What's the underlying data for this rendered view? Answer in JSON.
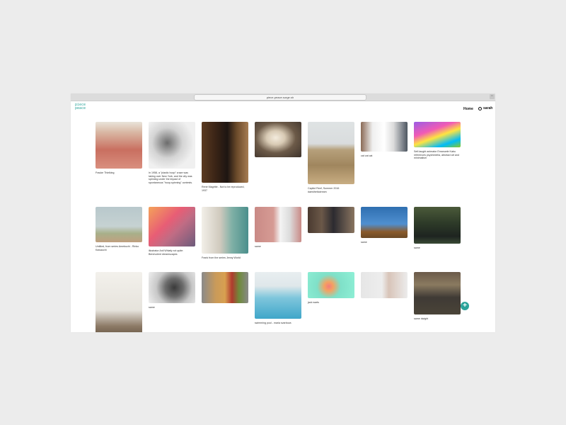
{
  "browser": {
    "url": "piece-peace.surge.sh"
  },
  "header": {
    "logo_line1": "piece",
    "logo_line2": "peace",
    "home": "Home",
    "user": "sarah"
  },
  "tiles": [
    {
      "caption": "Frauke Thielking"
    },
    {
      "caption": "In 1958, a \"plastic hoop\" craze was taking over New York, and the city was spinning under the impact of spontaneous \"hoop-spinning\" contests."
    },
    {
      "caption": "René Magritte - Not to be reproduced, 1937"
    },
    {
      "caption": ""
    },
    {
      "caption": "Capitol Reef, Summer 2016 #aestheticdream"
    },
    {
      "caption": "cat cat cat"
    },
    {
      "caption": "Self-taught animator Emanuele Kabu references psychedelia, abstract art and minimalism"
    },
    {
      "caption": "Untitled, from series Amebuchi - Rinko Kawauchi"
    },
    {
      "caption": "illustrator Anil Whiafy not quite: Benevolent dreamscapes"
    },
    {
      "caption": "Frank from the series Jenny World"
    },
    {
      "caption": "same"
    },
    {
      "caption": ""
    },
    {
      "caption": "same"
    },
    {
      "caption": "same"
    },
    {
      "caption": ""
    },
    {
      "caption": "same"
    },
    {
      "caption": ""
    },
    {
      "caption": "swimming pool - maria svarbova"
    },
    {
      "caption": "jack warts"
    },
    {
      "caption": ""
    },
    {
      "caption": "same dwight"
    }
  ],
  "add_button": "+"
}
